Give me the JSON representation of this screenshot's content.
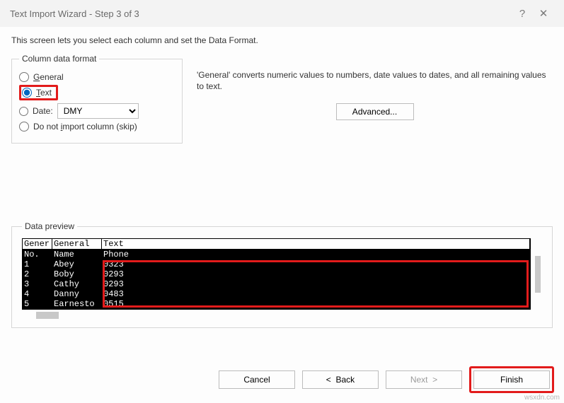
{
  "title": "Text Import Wizard - Step 3 of 3",
  "intro": "This screen lets you select each column and set the Data Format.",
  "coldata": {
    "legend": "Column data format",
    "general": "General",
    "text": "Text",
    "date": "Date:",
    "date_value": "DMY",
    "skip": "Do not import column (skip)"
  },
  "general_desc": "'General' converts numeric values to numbers, date values to dates, and all remaining values to text.",
  "advanced_label": "Advanced...",
  "preview": {
    "legend": "Data preview",
    "headers": [
      "Gener",
      "General",
      "Text"
    ],
    "rows": [
      [
        "No.",
        "Name",
        "Phone"
      ],
      [
        "1",
        "Abey",
        "0323"
      ],
      [
        "2",
        "Boby",
        "0293"
      ],
      [
        "3",
        "Cathy",
        "0293"
      ],
      [
        "4",
        "Danny",
        "0483"
      ],
      [
        "5",
        "Earnesto",
        "0515"
      ]
    ]
  },
  "buttons": {
    "cancel": "Cancel",
    "back": "<  Back",
    "next": "Next  >",
    "finish": "Finish"
  },
  "watermark": "wsxdn.com"
}
